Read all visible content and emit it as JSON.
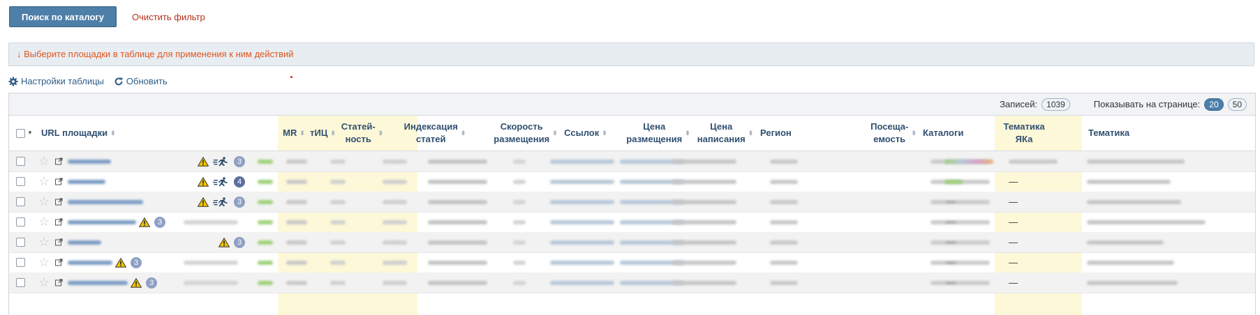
{
  "toolbar": {
    "search_label": "Поиск по каталогу",
    "clear_label": "Очистить фильтр"
  },
  "info": {
    "text": "↓  Выберите площадки в таблице для применения к ним действий"
  },
  "tools": {
    "settings_label": "Настройки таблицы",
    "refresh_label": "Обновить"
  },
  "pager": {
    "records_label": "Записей:",
    "records_count": "1039",
    "per_page_label": "Показывать на странице:",
    "per_page_options": [
      "20",
      "50"
    ],
    "per_page_selected": "20"
  },
  "columns": {
    "url": "URL площадки",
    "mr": "MR",
    "tic": "тИЦ",
    "articles_l1": "Статей-",
    "articles_l2": "ность",
    "indexing_l1": "Индексация",
    "indexing_l2": "статей",
    "speed_l1": "Скорость",
    "speed_l2": "размещения",
    "links": "Ссылок",
    "price_l1": "Цена",
    "price_l2": "размещения",
    "write_l1": "Цена",
    "write_l2": "написания",
    "region": "Регион",
    "traffic_l1": "Посеща-",
    "traffic_l2": "емость",
    "catalogs": "Каталоги",
    "yaca_l1": "Тематика",
    "yaca_l2": "ЯКа",
    "topic": "Тематика"
  },
  "colors": {
    "primary": "#4d7fa8",
    "highlight_column": "#fdf8d8",
    "warning": "#f2c200",
    "badge": "#8ea0c4"
  },
  "rows": [
    {
      "badge": "3",
      "warn": true,
      "runner": true,
      "yaca": ""
    },
    {
      "badge": "4",
      "warn": true,
      "runner": true,
      "yaca": "—"
    },
    {
      "badge": "3",
      "warn": true,
      "runner": true,
      "yaca": "—"
    },
    {
      "badge": "3",
      "warn": true,
      "runner": false,
      "yaca": "—"
    },
    {
      "badge": "3",
      "warn": true,
      "runner": false,
      "yaca": "—"
    },
    {
      "badge": "3",
      "warn": true,
      "runner": false,
      "yaca": "—"
    },
    {
      "badge": "3",
      "warn": true,
      "runner": false,
      "yaca": "—"
    }
  ]
}
